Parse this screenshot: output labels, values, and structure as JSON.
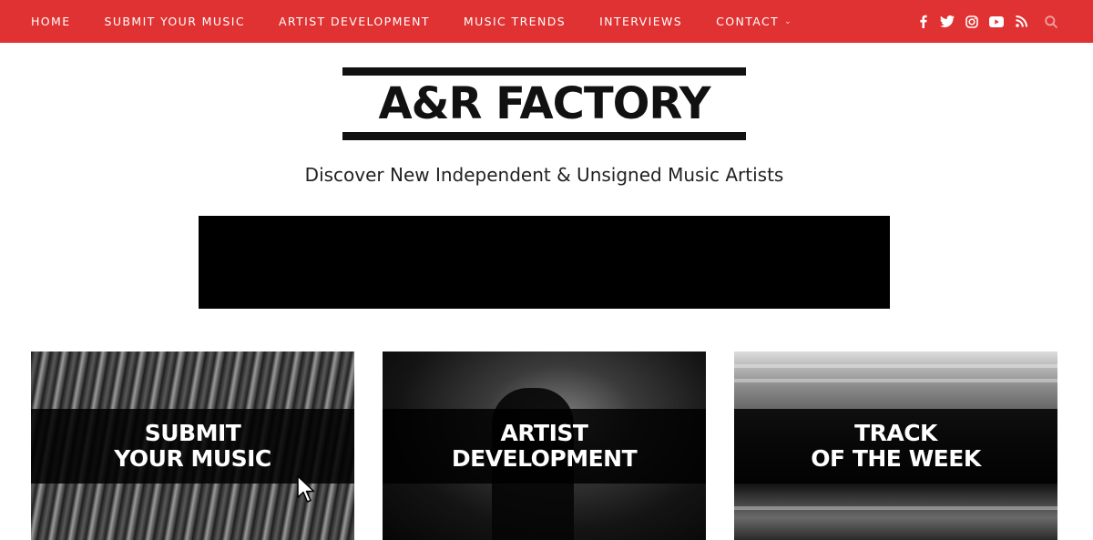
{
  "nav": {
    "items": [
      {
        "label": "HOME"
      },
      {
        "label": "SUBMIT YOUR MUSIC"
      },
      {
        "label": "ARTIST DEVELOPMENT"
      },
      {
        "label": "MUSIC TRENDS"
      },
      {
        "label": "INTERVIEWS"
      },
      {
        "label": "CONTACT",
        "has_dropdown": true
      }
    ],
    "chevron_glyph": "⌄"
  },
  "social": [
    "facebook-icon",
    "twitter-icon",
    "instagram-icon",
    "youtube-icon",
    "rss-icon",
    "search-icon"
  ],
  "colors": {
    "nav_bg": "#e03232",
    "text": "#222222",
    "logo": "#111111"
  },
  "logo": {
    "text": "A&R FACTORY"
  },
  "tagline": "Discover New Independent & Unsigned Music Artists",
  "cards": [
    {
      "title": "SUBMIT\nYOUR MUSIC"
    },
    {
      "title": "ARTIST\nDEVELOPMENT"
    },
    {
      "title": "TRACK\nOF THE WEEK"
    }
  ]
}
